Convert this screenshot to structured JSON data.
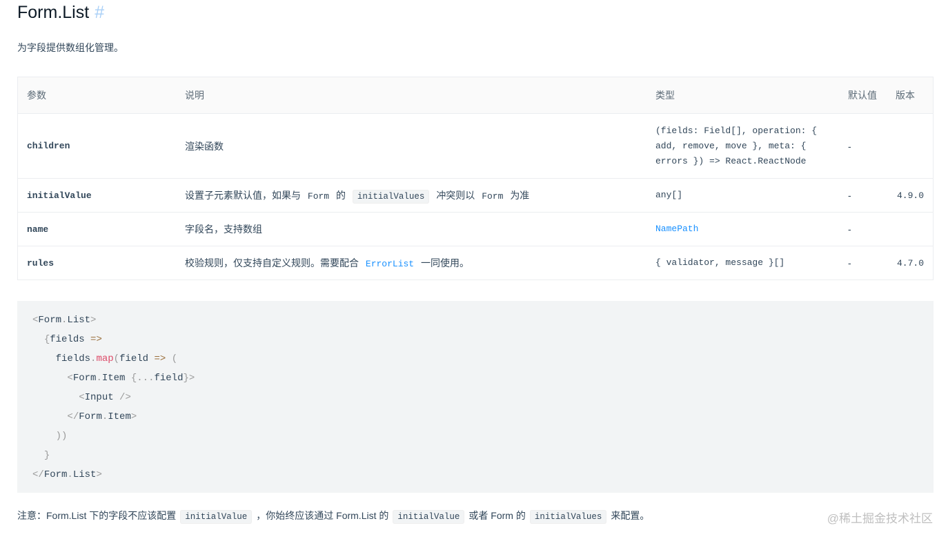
{
  "section": {
    "title": "Form.List",
    "anchor": "#",
    "description": "为字段提供数组化管理。"
  },
  "table": {
    "headers": [
      "参数",
      "说明",
      "类型",
      "默认值",
      "版本"
    ],
    "rows": [
      {
        "name": "children",
        "desc": "渲染函数",
        "type_lines": [
          "(fields: Field[], operation: {",
          "add, remove, move }, meta: {",
          "errors }) => React.ReactNode"
        ],
        "default": "-",
        "version": ""
      },
      {
        "name": "initialValue",
        "desc_parts": [
          "设置子元素默认值，如果与",
          "Form",
          "的",
          "initialValues",
          "冲突则以",
          "Form",
          "为准"
        ],
        "type": "any[]",
        "default": "-",
        "version": "4.9.0"
      },
      {
        "name": "name",
        "desc": "字段名，支持数组",
        "type": "NamePath",
        "default": "-",
        "version": ""
      },
      {
        "name": "rules",
        "desc_parts": [
          "校验规则，仅支持自定义规则。需要配合",
          "ErrorList",
          "一同使用。"
        ],
        "type": "{ validator, message }[]",
        "default": "-",
        "version": "4.7.0"
      }
    ]
  },
  "code": {
    "lines": [
      "<Form.List>",
      "  {fields =>",
      "    fields.map(field => (",
      "      <Form.Item {...field}>",
      "        <Input />",
      "      </Form.Item>",
      "    ))",
      "  }",
      "</Form.List>"
    ]
  },
  "note": {
    "parts": [
      "注意：Form.List 下的字段不应该配置",
      "initialValue",
      "，你始终应该通过 Form.List 的",
      "initialValue",
      "或者 Form 的",
      "initialValues",
      "来配置。"
    ]
  },
  "watermark": "@稀土掘金技术社区",
  "colors": {
    "type_text": "#c41d7f",
    "link": "#1890ff",
    "code_bg": "#f2f4f5",
    "anchor": "#a8cff7"
  }
}
